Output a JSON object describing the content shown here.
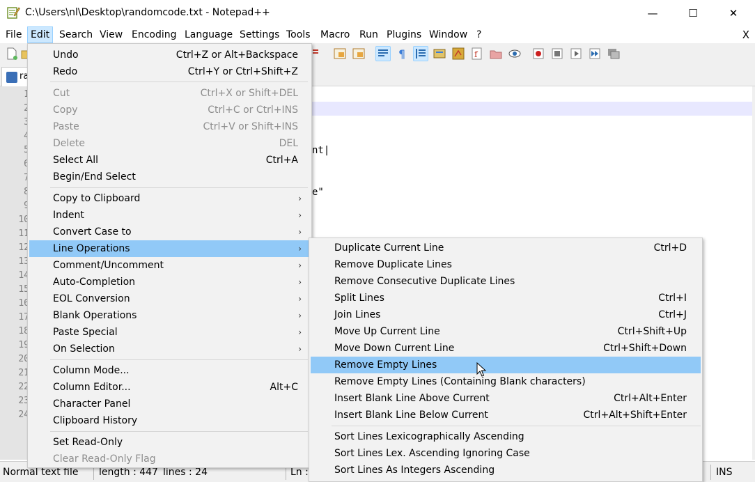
{
  "window": {
    "title": "C:\\Users\\nl\\Desktop\\randomcode.txt - Notepad++",
    "minimize_glyph": "—",
    "maximize_glyph": "☐",
    "close_glyph": "✕"
  },
  "menubar": {
    "items": [
      "File",
      "Edit",
      "Search",
      "View",
      "Encoding",
      "Language",
      "Settings",
      "Tools",
      "Macro",
      "Run",
      "Plugins",
      "Window",
      "?"
    ],
    "close_doc": "X",
    "active": "Edit"
  },
  "tab": {
    "label": "ra"
  },
  "editor": {
    "line_numbers": [
      "1",
      "2",
      "3",
      "4",
      "5",
      "6",
      "7",
      "8",
      "9",
      "10",
      "11",
      "12",
      "13",
      "14",
      "15",
      "16",
      "17",
      "18",
      "19",
      "20",
      "21",
      "22",
      "23",
      "24"
    ],
    "visible_fragments": [
      "nt|",
      "e\""
    ]
  },
  "statusbar": {
    "type": "Normal text file",
    "length": "length : 447",
    "lines": "lines : 24",
    "position": "Ln :",
    "mode": "INS"
  },
  "edit_menu": {
    "items": [
      {
        "label": "Undo",
        "shortcut": "Ctrl+Z or Alt+Backspace"
      },
      {
        "label": "Redo",
        "shortcut": "Ctrl+Y or Ctrl+Shift+Z"
      },
      {
        "label": "Cut",
        "shortcut": "Ctrl+X or Shift+DEL",
        "disabled": true
      },
      {
        "label": "Copy",
        "shortcut": "Ctrl+C or Ctrl+INS",
        "disabled": true
      },
      {
        "label": "Paste",
        "shortcut": "Ctrl+V or Shift+INS",
        "disabled": true
      },
      {
        "label": "Delete",
        "shortcut": "DEL",
        "disabled": true
      },
      {
        "label": "Select All",
        "shortcut": "Ctrl+A"
      },
      {
        "label": "Begin/End Select",
        "shortcut": ""
      },
      {
        "label": "Copy to Clipboard",
        "submenu": true
      },
      {
        "label": "Indent",
        "submenu": true
      },
      {
        "label": "Convert Case to",
        "submenu": true
      },
      {
        "label": "Line Operations",
        "submenu": true,
        "highlighted": true
      },
      {
        "label": "Comment/Uncomment",
        "submenu": true
      },
      {
        "label": "Auto-Completion",
        "submenu": true
      },
      {
        "label": "EOL Conversion",
        "submenu": true
      },
      {
        "label": "Blank Operations",
        "submenu": true
      },
      {
        "label": "Paste Special",
        "submenu": true
      },
      {
        "label": "On Selection",
        "submenu": true
      },
      {
        "label": "Column Mode...",
        "shortcut": ""
      },
      {
        "label": "Column Editor...",
        "shortcut": "Alt+C"
      },
      {
        "label": "Character Panel",
        "shortcut": ""
      },
      {
        "label": "Clipboard History",
        "shortcut": ""
      },
      {
        "label": "Set Read-Only",
        "shortcut": ""
      },
      {
        "label": "Clear Read-Only Flag",
        "shortcut": "",
        "disabled": true
      }
    ]
  },
  "line_ops_menu": {
    "items": [
      {
        "label": "Duplicate Current Line",
        "shortcut": "Ctrl+D"
      },
      {
        "label": "Remove Duplicate Lines",
        "shortcut": ""
      },
      {
        "label": "Remove Consecutive Duplicate Lines",
        "shortcut": ""
      },
      {
        "label": "Split Lines",
        "shortcut": "Ctrl+I"
      },
      {
        "label": "Join Lines",
        "shortcut": "Ctrl+J"
      },
      {
        "label": "Move Up Current Line",
        "shortcut": "Ctrl+Shift+Up"
      },
      {
        "label": "Move Down Current Line",
        "shortcut": "Ctrl+Shift+Down"
      },
      {
        "label": "Remove Empty Lines",
        "shortcut": "",
        "highlighted": true
      },
      {
        "label": "Remove Empty Lines (Containing Blank characters)",
        "shortcut": ""
      },
      {
        "label": "Insert Blank Line Above Current",
        "shortcut": "Ctrl+Alt+Enter"
      },
      {
        "label": "Insert Blank Line Below Current",
        "shortcut": "Ctrl+Alt+Shift+Enter"
      },
      {
        "label": "Sort Lines Lexicographically Ascending",
        "shortcut": ""
      },
      {
        "label": "Sort Lines Lex. Ascending Ignoring Case",
        "shortcut": ""
      },
      {
        "label": "Sort Lines As Integers Ascending",
        "shortcut": ""
      }
    ]
  },
  "submenu_arrow": "›",
  "colors": {
    "menu_bg": "#f2f2f2",
    "highlight": "#91c9f7",
    "menubar_active": "#cce8ff",
    "disabled_text": "#8d8d8d"
  }
}
